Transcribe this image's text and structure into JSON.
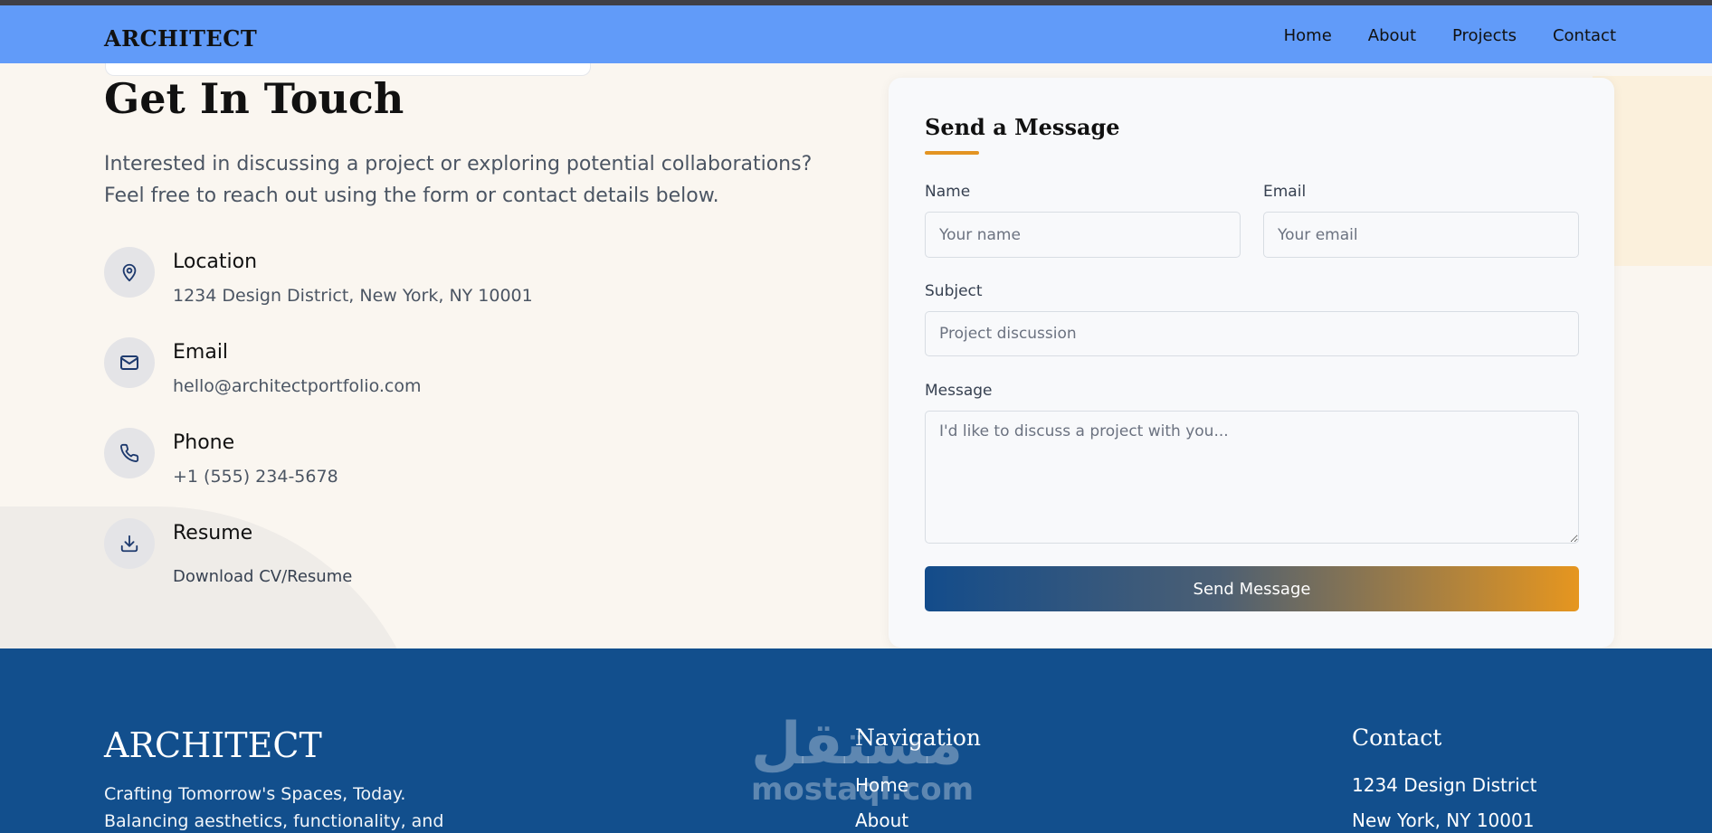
{
  "nav": {
    "brand": "ARCHITECT",
    "links": [
      "Home",
      "About",
      "Projects",
      "Contact"
    ]
  },
  "contact": {
    "heading": "Get In Touch",
    "intro": "Interested in discussing a project or exploring potential collaborations? Feel free to reach out using the form or contact details below.",
    "items": [
      {
        "icon": "map-pin-icon",
        "title": "Location",
        "text": "1234 Design District, New York, NY 10001"
      },
      {
        "icon": "mail-icon",
        "title": "Email",
        "text": "hello@architectportfolio.com"
      },
      {
        "icon": "phone-icon",
        "title": "Phone",
        "text": "+1 (555) 234-5678"
      },
      {
        "icon": "download-icon",
        "title": "Resume",
        "text": "Download CV/Resume"
      }
    ]
  },
  "form": {
    "title": "Send a Message",
    "name_label": "Name",
    "name_placeholder": "Your name",
    "email_label": "Email",
    "email_placeholder": "Your email",
    "subject_label": "Subject",
    "subject_placeholder": "Project discussion",
    "message_label": "Message",
    "message_placeholder": "I'd like to discuss a project with you...",
    "submit_label": "Send Message"
  },
  "footer": {
    "brand": "ARCHITECT",
    "tagline": "Crafting Tomorrow's Spaces, Today. Balancing aesthetics, functionality, and",
    "navigation_heading": "Navigation",
    "navigation_links": [
      "Home",
      "About"
    ],
    "contact_heading": "Contact",
    "contact_lines": [
      "1234 Design District",
      "New York, NY 10001"
    ]
  },
  "watermark": {
    "arabic": "مستقل",
    "latin": "mostaql.com"
  },
  "colors": {
    "navbar": "#619bf9",
    "page_bg": "#faf6f0",
    "accent": "#e39422",
    "footer_bg": "#124f8d",
    "button_gradient_start": "#134c8b",
    "button_gradient_end": "#e6961f"
  }
}
